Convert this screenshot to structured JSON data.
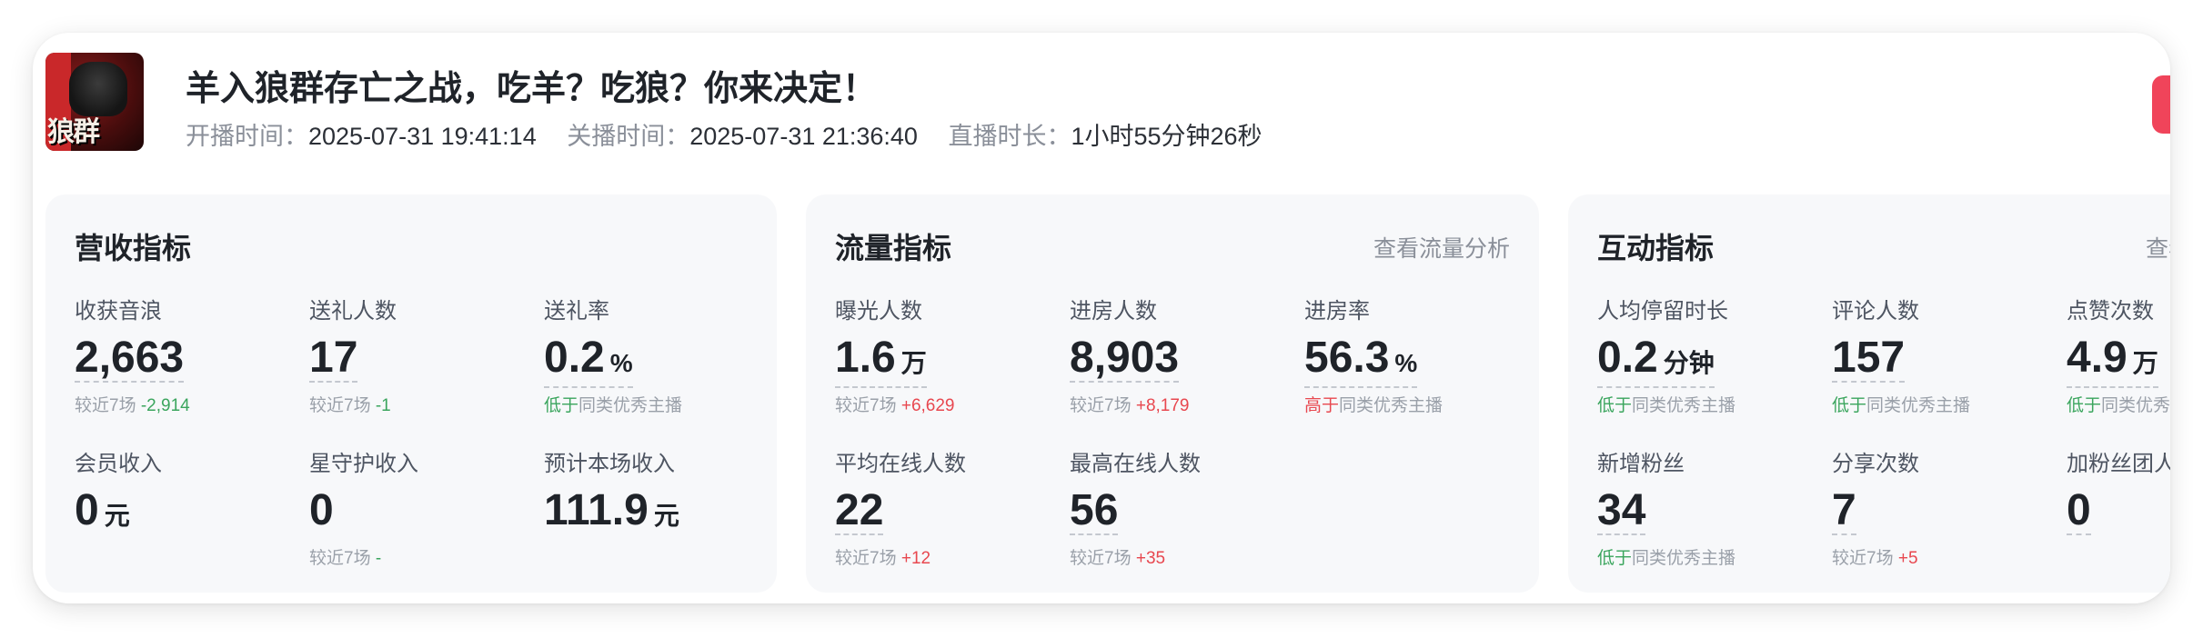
{
  "header": {
    "cover_text": "狼群",
    "title": "羊入狼群存亡之战，吃羊？吃狼？你来决定！",
    "start_label": "开播时间：",
    "start_value": "2025-07-31 19:41:14",
    "end_label": "关播时间：",
    "end_value": "2025-07-31 21:36:40",
    "duration_label": "直播时长：",
    "duration_value": "1小时55分钟26秒"
  },
  "revenue": {
    "title": "营收指标",
    "metrics": [
      {
        "label": "收获音浪",
        "value": "2,663",
        "unit": "",
        "sub_prefix": "较近7场",
        "sub_value": "-2,914"
      },
      {
        "label": "送礼人数",
        "value": "17",
        "unit": "",
        "sub_prefix": "较近7场",
        "sub_value": "-1"
      },
      {
        "label": "送礼率",
        "value": "0.2",
        "unit": "%",
        "sub_tag": "低于",
        "sub_text": "同类优秀主播"
      },
      {
        "label": "会员收入",
        "value": "0",
        "unit": "元"
      },
      {
        "label": "星守护收入",
        "value": "0",
        "unit": "",
        "sub_prefix": "较近7场",
        "sub_value": "-"
      },
      {
        "label": "预计本场收入",
        "value": "111.9",
        "unit": "元"
      }
    ]
  },
  "traffic": {
    "title": "流量指标",
    "link": "查看流量分析",
    "metrics": [
      {
        "label": "曝光人数",
        "value": "1.6",
        "unit": "万",
        "sub_prefix": "较近7场",
        "sub_value": "+6,629"
      },
      {
        "label": "进房人数",
        "value": "8,903",
        "unit": "",
        "sub_prefix": "较近7场",
        "sub_value": "+8,179"
      },
      {
        "label": "进房率",
        "value": "56.3",
        "unit": "%",
        "sub_tag": "高于",
        "sub_text": "同类优秀主播"
      },
      {
        "label": "平均在线人数",
        "value": "22",
        "unit": "",
        "sub_prefix": "较近7场",
        "sub_value": "+12"
      },
      {
        "label": "最高在线人数",
        "value": "56",
        "unit": "",
        "sub_prefix": "较近7场",
        "sub_value": "+35"
      }
    ]
  },
  "interaction": {
    "title": "互动指标",
    "link": "查看",
    "metrics": [
      {
        "label": "人均停留时长",
        "value": "0.2",
        "unit": "分钟",
        "sub_tag": "低于",
        "sub_text": "同类优秀主播"
      },
      {
        "label": "评论人数",
        "value": "157",
        "unit": "",
        "sub_tag": "低于",
        "sub_text": "同类优秀主播"
      },
      {
        "label": "点赞次数",
        "value": "4.9",
        "unit": "万",
        "sub_tag": "低于",
        "sub_text": "同类优秀"
      },
      {
        "label": "新增粉丝",
        "value": "34",
        "unit": "",
        "sub_tag": "低于",
        "sub_text": "同类优秀主播"
      },
      {
        "label": "分享次数",
        "value": "7",
        "unit": "",
        "sub_prefix": "较近7场",
        "sub_value": "+5"
      },
      {
        "label": "加粉丝团人",
        "value": "0",
        "unit": ""
      }
    ]
  }
}
